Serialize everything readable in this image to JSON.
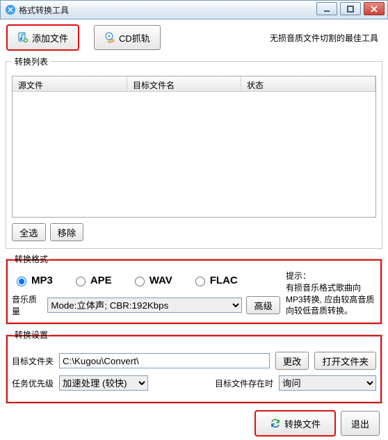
{
  "window": {
    "title": "格式转换工具"
  },
  "toolbar": {
    "add_file": "添加文件",
    "cd_rip": "CD抓轨",
    "slogan": "无损音质文件切割的最佳工具"
  },
  "list": {
    "legend": "转换列表",
    "col_source": "源文件",
    "col_target": "目标文件名",
    "col_status": "状态",
    "select_all": "全选",
    "remove": "移除"
  },
  "format": {
    "legend": "转换格式",
    "options": {
      "mp3": "MP3",
      "ape": "APE",
      "wav": "WAV",
      "flac": "FLAC"
    },
    "selected": "mp3",
    "quality_label": "音乐质量",
    "quality_value": "Mode:立体声; CBR:192Kbps",
    "advanced": "高级",
    "hint_title": "提示：",
    "hint_body": "有损音乐格式歌曲向MP3转换, 应由较高音质向较低音质转换。"
  },
  "settings": {
    "legend": "转换设置",
    "target_folder_label": "目标文件夹",
    "target_folder_value": "C:\\Kugou\\Convert\\",
    "change": "更改",
    "open_folder": "打开文件夹",
    "priority_label": "任务优先级",
    "priority_value": "加速处理 (较快)",
    "exists_label": "目标文件存在时",
    "exists_value": "询问"
  },
  "footer": {
    "convert": "转换文件",
    "exit": "退出"
  },
  "icons": {
    "add_file": "music-plus-icon",
    "cd": "cd-hand-icon",
    "convert": "recycle-arrows-icon"
  }
}
